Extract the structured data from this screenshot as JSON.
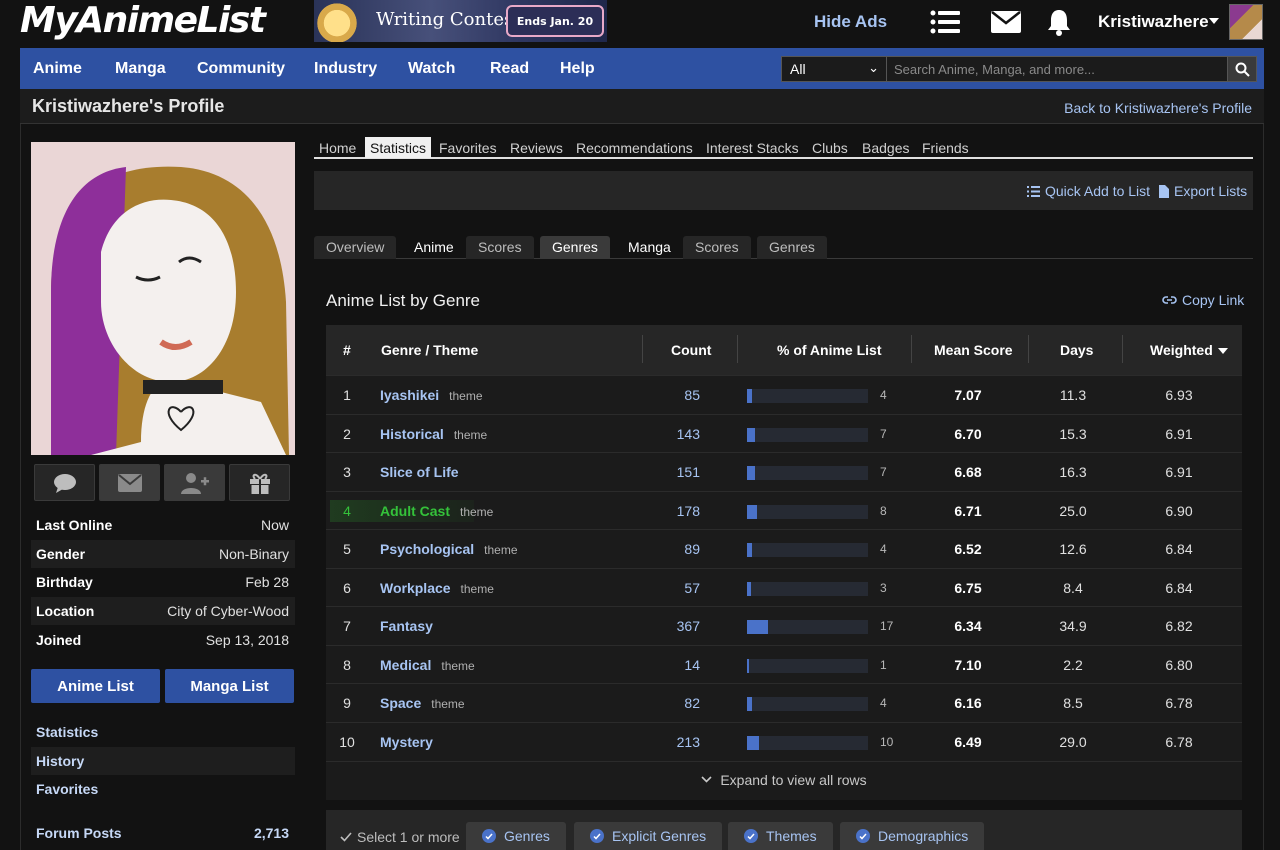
{
  "brand": {
    "logo": "MyAnimeList"
  },
  "banner": {
    "title": "Writing Contest",
    "badge": "Ends Jan. 20"
  },
  "header": {
    "hide_ads": "Hide Ads",
    "username": "Kristiwazhere"
  },
  "nav": {
    "items": [
      "Anime",
      "Manga",
      "Community",
      "Industry",
      "Watch",
      "Read",
      "Help"
    ],
    "search_scope": "All",
    "search_placeholder": "Search Anime, Manga, and more..."
  },
  "page": {
    "title": "Kristiwazhere's Profile",
    "back_link": "Back to Kristiwazhere's Profile"
  },
  "profile_tabs": [
    "Home",
    "Statistics",
    "Favorites",
    "Reviews",
    "Recommendations",
    "Interest Stacks",
    "Clubs",
    "Badges",
    "Friends"
  ],
  "quickbar": {
    "quick_add": "Quick Add to List",
    "export": "Export Lists"
  },
  "stat_tabs": [
    "Overview",
    "Anime",
    "Scores",
    "Genres",
    "Manga",
    "Scores",
    "Genres"
  ],
  "section": {
    "title": "Anime List by Genre",
    "copy_link": "Copy Link"
  },
  "table": {
    "headers": [
      "#",
      "Genre / Theme",
      "Count",
      "% of Anime List",
      "Mean Score",
      "Days",
      "Weighted"
    ],
    "rows": [
      {
        "rank": "1",
        "name": "Iyashikei",
        "tag": "theme",
        "count": "85",
        "pct": "4",
        "pct_value": 4,
        "mean": "7.07",
        "days": "11.3",
        "weighted": "6.93"
      },
      {
        "rank": "2",
        "name": "Historical",
        "tag": "theme",
        "count": "143",
        "pct": "7",
        "pct_value": 7,
        "mean": "6.70",
        "days": "15.3",
        "weighted": "6.91"
      },
      {
        "rank": "3",
        "name": "Slice of Life",
        "tag": "",
        "count": "151",
        "pct": "7",
        "pct_value": 7,
        "mean": "6.68",
        "days": "16.3",
        "weighted": "6.91"
      },
      {
        "rank": "4",
        "name": "Adult Cast",
        "tag": "theme",
        "count": "178",
        "pct": "8",
        "pct_value": 8,
        "mean": "6.71",
        "days": "25.0",
        "weighted": "6.90",
        "highlighted": true
      },
      {
        "rank": "5",
        "name": "Psychological",
        "tag": "theme",
        "count": "89",
        "pct": "4",
        "pct_value": 4,
        "mean": "6.52",
        "days": "12.6",
        "weighted": "6.84"
      },
      {
        "rank": "6",
        "name": "Workplace",
        "tag": "theme",
        "count": "57",
        "pct": "3",
        "pct_value": 3,
        "mean": "6.75",
        "days": "8.4",
        "weighted": "6.84"
      },
      {
        "rank": "7",
        "name": "Fantasy",
        "tag": "",
        "count": "367",
        "pct": "17",
        "pct_value": 17,
        "mean": "6.34",
        "days": "34.9",
        "weighted": "6.82"
      },
      {
        "rank": "8",
        "name": "Medical",
        "tag": "theme",
        "count": "14",
        "pct": "1",
        "pct_value": 1,
        "mean": "7.10",
        "days": "2.2",
        "weighted": "6.80"
      },
      {
        "rank": "9",
        "name": "Space",
        "tag": "theme",
        "count": "82",
        "pct": "4",
        "pct_value": 4,
        "mean": "6.16",
        "days": "8.5",
        "weighted": "6.78"
      },
      {
        "rank": "10",
        "name": "Mystery",
        "tag": "",
        "count": "213",
        "pct": "10",
        "pct_value": 10,
        "mean": "6.49",
        "days": "29.0",
        "weighted": "6.78"
      }
    ],
    "expand": "Expand to view all rows"
  },
  "filters": {
    "label": "Select 1 or more",
    "buttons": [
      "Genres",
      "Explicit Genres",
      "Themes",
      "Demographics"
    ]
  },
  "sidebar": {
    "info": [
      {
        "k": "Last Online",
        "v": "Now"
      },
      {
        "k": "Gender",
        "v": "Non-Binary"
      },
      {
        "k": "Birthday",
        "v": "Feb 28"
      },
      {
        "k": "Location",
        "v": "City of Cyber-Wood"
      },
      {
        "k": "Joined",
        "v": "Sep 13, 2018"
      }
    ],
    "anime_list": "Anime List",
    "manga_list": "Manga List",
    "links": [
      "Statistics",
      "History",
      "Favorites"
    ],
    "forum_posts": {
      "k": "Forum Posts",
      "v": "2,713"
    }
  },
  "colors": {
    "accent": "#2e51a2",
    "link": "#a7c4f2",
    "highlight": "#34c23a",
    "bar": "#4a72c9"
  }
}
